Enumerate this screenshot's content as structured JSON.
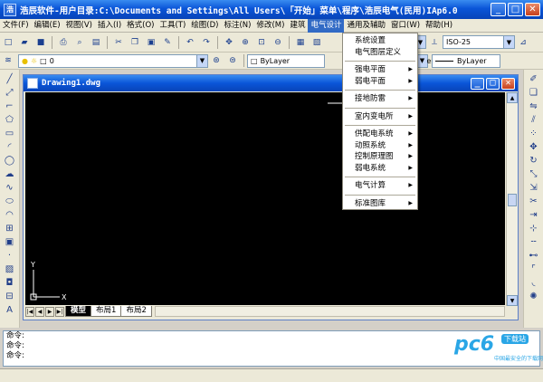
{
  "window": {
    "title": "浩辰软件-用户目录:C:\\Documents and Settings\\All Users\\「开始」菜单\\程序\\浩辰电气(民用)IAp6.0",
    "minimize": "_",
    "maximize": "□",
    "close": "✕"
  },
  "menubar": {
    "items": [
      "文件(F)",
      "编辑(E)",
      "视图(V)",
      "插入(I)",
      "格式(O)",
      "工具(T)",
      "绘图(D)",
      "标注(N)",
      "修改(M)",
      "建筑",
      "电气设计",
      "通用及辅助",
      "窗口(W)",
      "帮助(H)"
    ],
    "active": "电气设计"
  },
  "toolbar": {
    "layer_value": "0",
    "color_value": "ByLayer",
    "linetype_value": "ByLayer",
    "lineweight_value": "ByLayer",
    "dimstyle_value": "ISO-25"
  },
  "drawing": {
    "title": "Drawing1.dwg",
    "tabs": [
      "模型",
      "布局1",
      "布局2"
    ],
    "axis_y": "Y",
    "axis_x": "X"
  },
  "dropdown": {
    "items": [
      {
        "label": "系统设置",
        "submenu": false
      },
      {
        "label": "电气图层定义",
        "submenu": false
      },
      {
        "sep": true
      },
      {
        "label": "强电平面",
        "submenu": true
      },
      {
        "label": "弱电平面",
        "submenu": true
      },
      {
        "sep": true
      },
      {
        "label": "接地防雷",
        "submenu": true
      },
      {
        "sep": true
      },
      {
        "label": "室内变电所",
        "submenu": true
      },
      {
        "sep": true
      },
      {
        "label": "供配电系统",
        "submenu": true
      },
      {
        "label": "动照系统",
        "submenu": true
      },
      {
        "label": "控制原理图",
        "submenu": true
      },
      {
        "label": "弱电系统",
        "submenu": true
      },
      {
        "sep": true
      },
      {
        "label": "电气计算",
        "submenu": true
      },
      {
        "sep": true
      },
      {
        "label": "标准图库",
        "submenu": true
      }
    ]
  },
  "command": {
    "lines": [
      "命令:",
      "命令:",
      "命令:"
    ]
  },
  "logo": {
    "main": "pc6",
    "badge": "下载站",
    "slogan": "中国最安全的下载网站"
  },
  "colors": {
    "titlebar": "#0a55d8",
    "canvas": "#000000",
    "menu_highlight": "#316ac5"
  }
}
